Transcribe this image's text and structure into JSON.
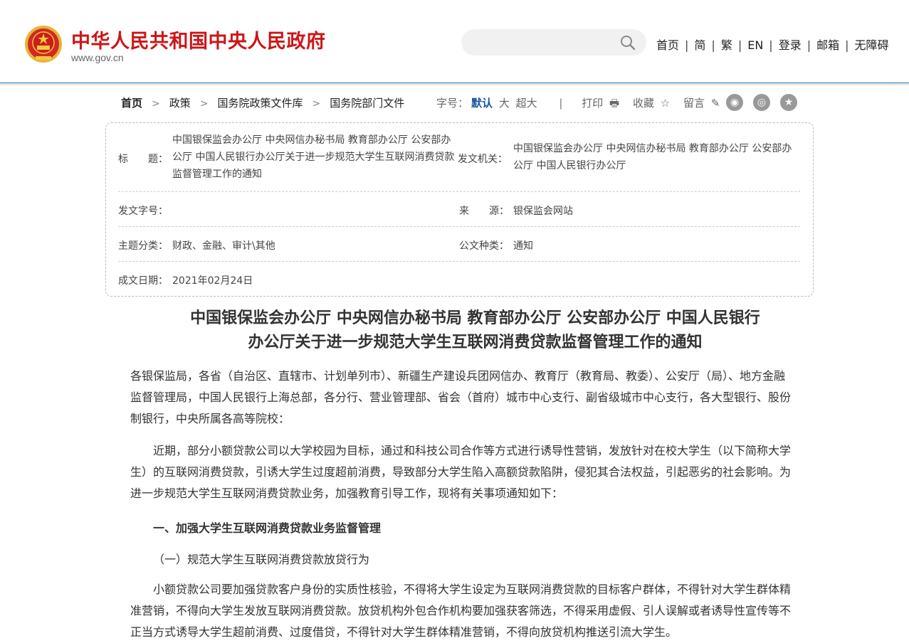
{
  "header": {
    "site_title": "中华人民共和国中央人民政府",
    "site_url": "www.gov.cn",
    "search_placeholder": "",
    "nav": [
      "首页",
      "简",
      "繁",
      "EN",
      "登录",
      "邮箱",
      "无障碍"
    ]
  },
  "breadcrumb": [
    "首页",
    "政策",
    "国务院政策文件库",
    "国务院部门文件"
  ],
  "toolbar": {
    "font_label": "字号：",
    "font_sizes": [
      "默认",
      "大",
      "超大"
    ],
    "print": "打印",
    "favorite": "收藏",
    "comment": "留言"
  },
  "meta": {
    "title_label": "标　　题：",
    "title_value": "中国银保监会办公厅 中央网信办秘书局 教育部办公厅 公安部办公厅 中国人民银行办公厅关于进一步规范大学生互联网消费贷款监督管理工作的通知",
    "issuer_label": "发文机关：",
    "issuer_value": "中国银保监会办公厅 中央网信办秘书局 教育部办公厅 公安部办公厅 中国人民银行办公厅",
    "doc_no_label": "发文字号：",
    "doc_no_value": "",
    "source_label": "来　　源：",
    "source_value": "银保监会网站",
    "category_label": "主题分类：",
    "category_value": "财政、金融、审计\\其他",
    "type_label": "公文种类：",
    "type_value": "通知",
    "date_label": "成文日期：",
    "date_value": "2021年02月24日"
  },
  "article": {
    "title_line1": "中国银保监会办公厅 中央网信办秘书局 教育部办公厅 公安部办公厅 中国人民银行",
    "title_line2": "办公厅关于进一步规范大学生互联网消费贷款监督管理工作的通知",
    "addressee": "各银保监局，各省（自治区、直辖市、计划单列市）、新疆生产建设兵团网信办、教育厅（教育局、教委）、公安厅（局）、地方金融监督管理局，中国人民银行上海总部，各分行、营业管理部、省会（首府）城市中心支行、副省级城市中心支行，各大型银行、股份制银行，中央所属各高等院校：",
    "para1": "近期，部分小额贷款公司以大学校园为目标，通过和科技公司合作等方式进行诱导性营销，发放针对在校大学生（以下简称大学生）的互联网消费贷款，引诱大学生过度超前消费，导致部分大学生陷入高额贷款陷阱，侵犯其合法权益，引起恶劣的社会影响。为进一步规范大学生互联网消费贷款业务，加强教育引导工作，现将有关事项通知如下：",
    "heading1": "一、加强大学生互联网消费贷款业务监督管理",
    "heading2": "（一）规范大学生互联网消费贷款放贷行为",
    "para2": "小额贷款公司要加强贷款客户身份的实质性核验，不得将大学生设定为互联网消费贷款的目标客户群体，不得针对大学生群体精准营销，不得向大学生发放互联网消费贷款。放贷机构外包合作机构要加强获客筛选，不得采用虚假、引人误解或者诱导性宣传等不正当方式诱导大学生超前消费、过度借贷，不得针对大学生群体精准营销，不得向放贷机构推送引流大学生。"
  }
}
